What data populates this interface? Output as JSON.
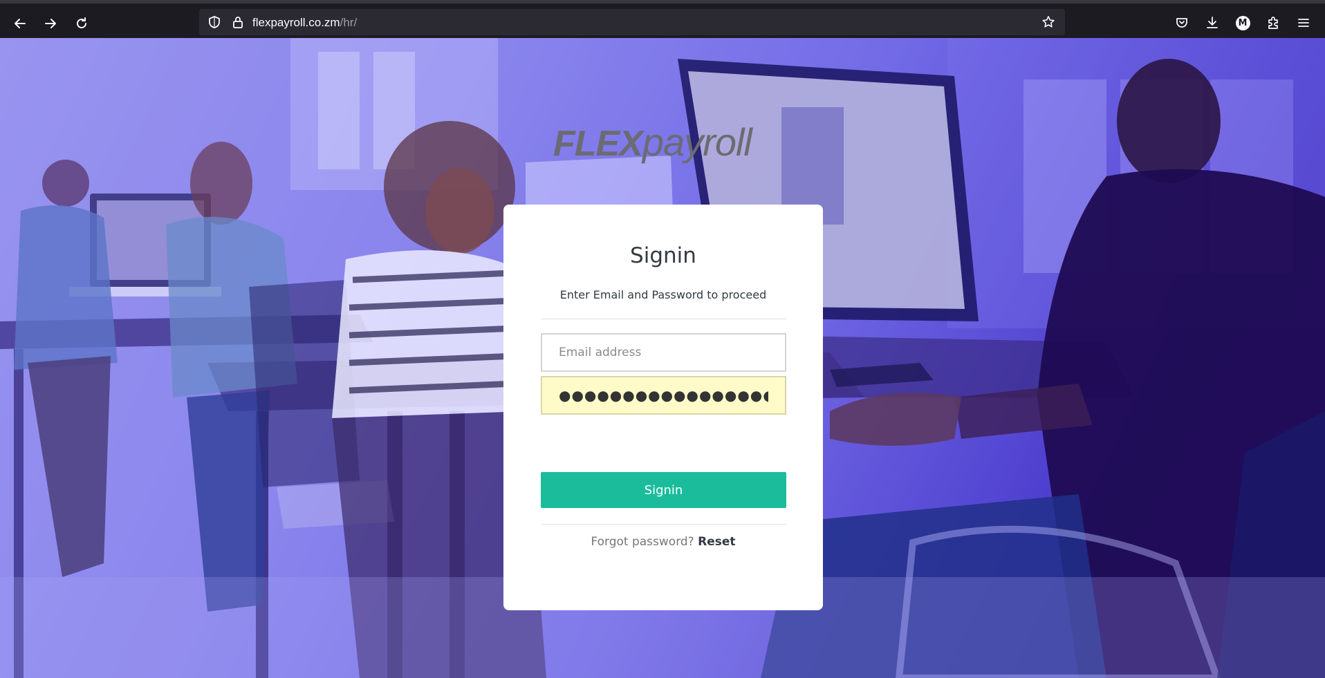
{
  "browser": {
    "url_host": "flexpayroll.co.zm",
    "url_path": "/hr/",
    "avatar_letter": "M",
    "icons": [
      "back-arrow-icon",
      "forward-arrow-icon",
      "reload-icon",
      "shield-icon",
      "lock-icon",
      "bookmark-star-icon",
      "pocket-icon",
      "download-icon",
      "account-avatar",
      "extensions-icon",
      "hamburger-menu-icon"
    ]
  },
  "logo": {
    "part1": "FLEX",
    "part2": "payroll"
  },
  "signin": {
    "title": "Signin",
    "subtitle": "Enter Email and Password to proceed",
    "email_placeholder": "Email address",
    "email_value": "",
    "password_value": "●●●●●●●●●●●●●●●●●",
    "button_label": "Signin",
    "forgot_text": "Forgot password?",
    "reset_label": "Reset"
  },
  "colors": {
    "accent": "#1abc9c",
    "overlay": "#4f3fd8",
    "autofill": "#fffbc8",
    "browser_bg": "#1c1b22",
    "urlbar_bg": "#2b2a33"
  }
}
